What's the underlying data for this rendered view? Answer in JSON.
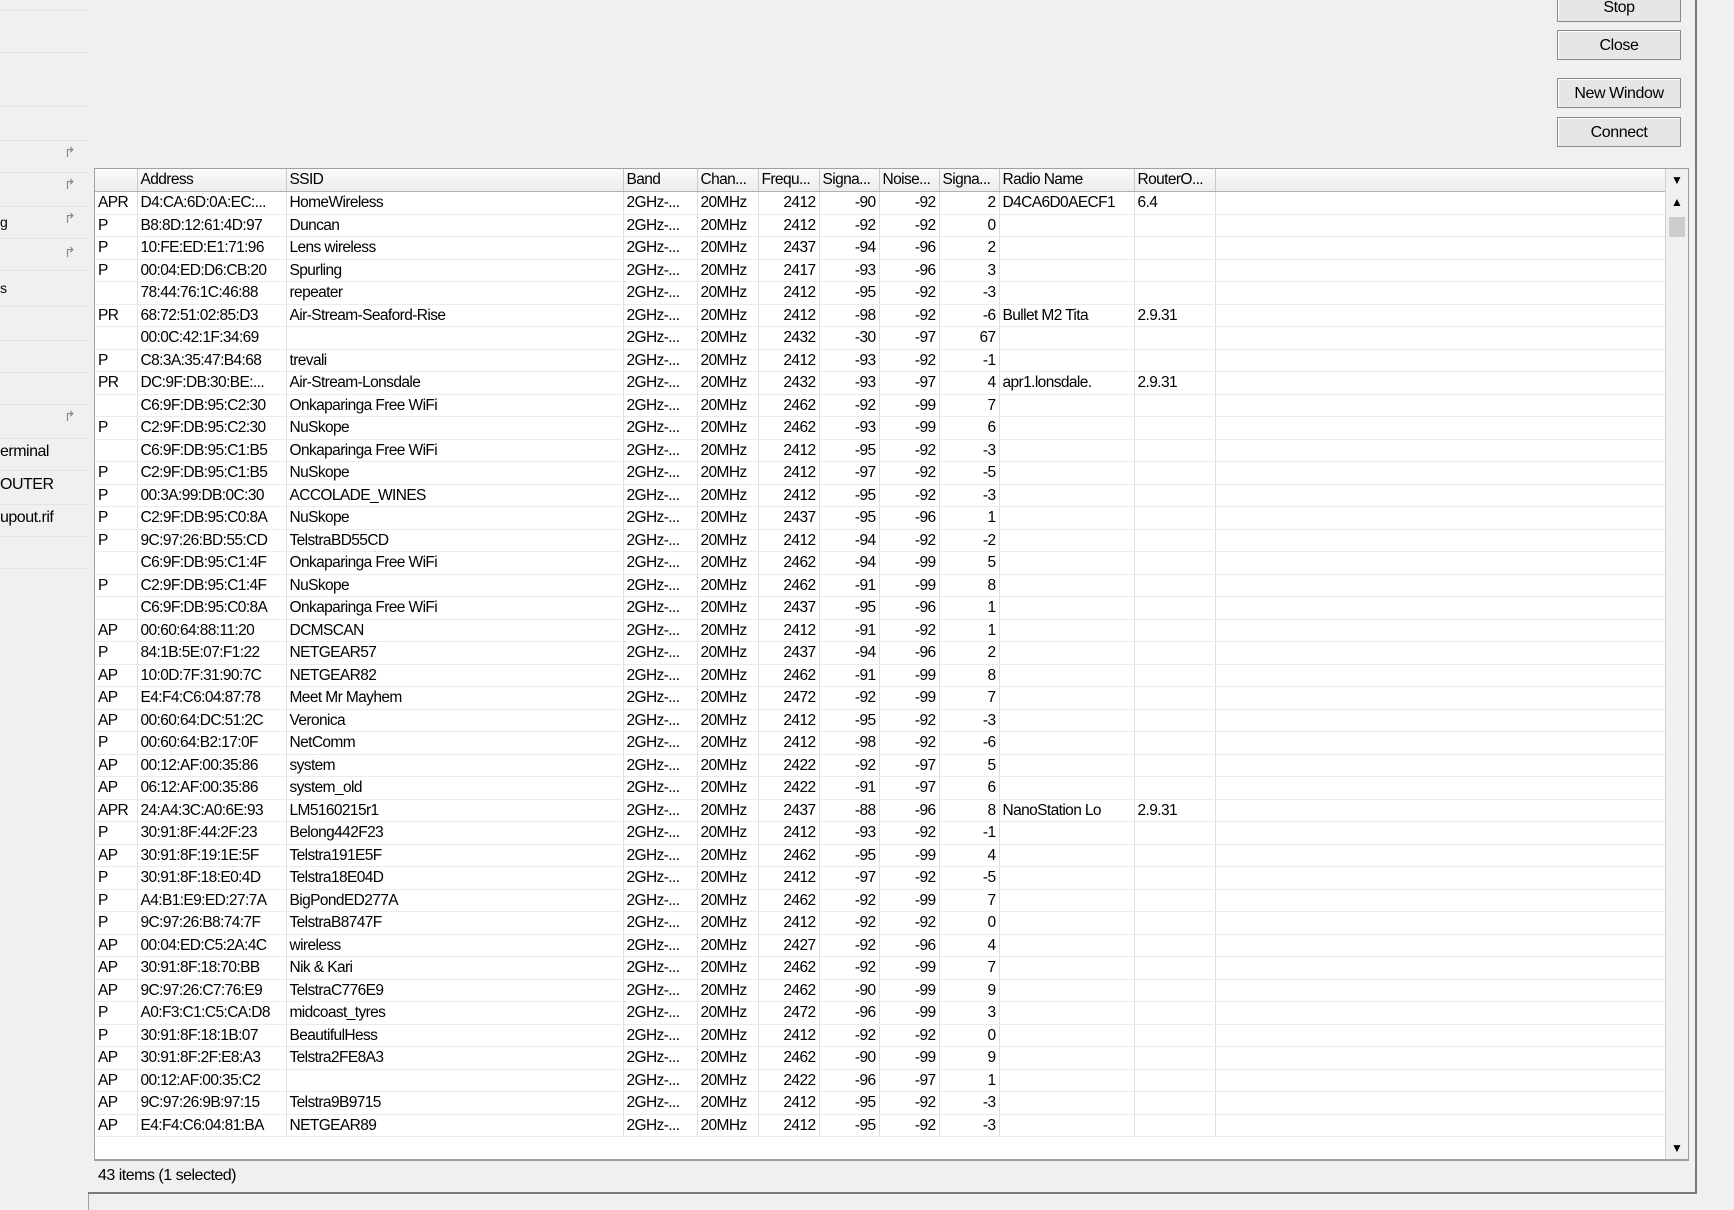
{
  "sidebar": {
    "items": [
      "erminal",
      "OUTER",
      "upout.rif"
    ],
    "marks": [
      "g",
      "s"
    ]
  },
  "buttons": {
    "stop": "Stop",
    "close": "Close",
    "new_window": "New Window",
    "connect": "Connect"
  },
  "table": {
    "columns": [
      "",
      "Address",
      "SSID",
      "Band",
      "Chan...",
      "Frequ...",
      "Signa...",
      "Noise...",
      "Signa...",
      "Radio Name",
      "RouterO..."
    ],
    "rows": [
      [
        "APR",
        "D4:CA:6D:0A:EC:...",
        "HomeWireless",
        "2GHz-...",
        "20MHz",
        "2412",
        "-90",
        "-92",
        "2",
        "D4CA6D0AECF1",
        "6.4"
      ],
      [
        "P",
        "B8:8D:12:61:4D:97",
        "Duncan",
        "2GHz-...",
        "20MHz",
        "2412",
        "-92",
        "-92",
        "0",
        "",
        ""
      ],
      [
        "P",
        "10:FE:ED:E1:71:96",
        "Lens wireless",
        "2GHz-...",
        "20MHz",
        "2437",
        "-94",
        "-96",
        "2",
        "",
        ""
      ],
      [
        "P",
        "00:04:ED:D6:CB:20",
        "Spurling",
        "2GHz-...",
        "20MHz",
        "2417",
        "-93",
        "-96",
        "3",
        "",
        ""
      ],
      [
        "",
        "78:44:76:1C:46:88",
        "repeater",
        "2GHz-...",
        "20MHz",
        "2412",
        "-95",
        "-92",
        "-3",
        "",
        ""
      ],
      [
        "PR",
        "68:72:51:02:85:D3",
        "Air-Stream-Seaford-Rise",
        "2GHz-...",
        "20MHz",
        "2412",
        "-98",
        "-92",
        "-6",
        "Bullet M2 Tita",
        "2.9.31"
      ],
      [
        "",
        "00:0C:42:1F:34:69",
        "",
        "2GHz-...",
        "20MHz",
        "2432",
        "-30",
        "-97",
        "67",
        "",
        ""
      ],
      [
        "P",
        "C8:3A:35:47:B4:68",
        "trevali",
        "2GHz-...",
        "20MHz",
        "2412",
        "-93",
        "-92",
        "-1",
        "",
        ""
      ],
      [
        "PR",
        "DC:9F:DB:30:BE:...",
        "Air-Stream-Lonsdale",
        "2GHz-...",
        "20MHz",
        "2432",
        "-93",
        "-97",
        "4",
        "apr1.lonsdale.",
        "2.9.31"
      ],
      [
        "",
        "C6:9F:DB:95:C2:30",
        "Onkaparinga Free WiFi",
        "2GHz-...",
        "20MHz",
        "2462",
        "-92",
        "-99",
        "7",
        "",
        ""
      ],
      [
        "P",
        "C2:9F:DB:95:C2:30",
        "NuSkope",
        "2GHz-...",
        "20MHz",
        "2462",
        "-93",
        "-99",
        "6",
        "",
        ""
      ],
      [
        "",
        "C6:9F:DB:95:C1:B5",
        "Onkaparinga Free WiFi",
        "2GHz-...",
        "20MHz",
        "2412",
        "-95",
        "-92",
        "-3",
        "",
        ""
      ],
      [
        "P",
        "C2:9F:DB:95:C1:B5",
        "NuSkope",
        "2GHz-...",
        "20MHz",
        "2412",
        "-97",
        "-92",
        "-5",
        "",
        ""
      ],
      [
        "P",
        "00:3A:99:DB:0C:30",
        "ACCOLADE_WINES",
        "2GHz-...",
        "20MHz",
        "2412",
        "-95",
        "-92",
        "-3",
        "",
        ""
      ],
      [
        "P",
        "C2:9F:DB:95:C0:8A",
        "NuSkope",
        "2GHz-...",
        "20MHz",
        "2437",
        "-95",
        "-96",
        "1",
        "",
        ""
      ],
      [
        "P",
        "9C:97:26:BD:55:CD",
        "TelstraBD55CD",
        "2GHz-...",
        "20MHz",
        "2412",
        "-94",
        "-92",
        "-2",
        "",
        ""
      ],
      [
        "",
        "C6:9F:DB:95:C1:4F",
        "Onkaparinga Free WiFi",
        "2GHz-...",
        "20MHz",
        "2462",
        "-94",
        "-99",
        "5",
        "",
        ""
      ],
      [
        "P",
        "C2:9F:DB:95:C1:4F",
        "NuSkope",
        "2GHz-...",
        "20MHz",
        "2462",
        "-91",
        "-99",
        "8",
        "",
        ""
      ],
      [
        "",
        "C6:9F:DB:95:C0:8A",
        "Onkaparinga Free WiFi",
        "2GHz-...",
        "20MHz",
        "2437",
        "-95",
        "-96",
        "1",
        "",
        ""
      ],
      [
        "AP",
        "00:60:64:88:11:20",
        "DCMSCAN",
        "2GHz-...",
        "20MHz",
        "2412",
        "-91",
        "-92",
        "1",
        "",
        ""
      ],
      [
        "P",
        "84:1B:5E:07:F1:22",
        "NETGEAR57",
        "2GHz-...",
        "20MHz",
        "2437",
        "-94",
        "-96",
        "2",
        "",
        ""
      ],
      [
        "AP",
        "10:0D:7F:31:90:7C",
        "NETGEAR82",
        "2GHz-...",
        "20MHz",
        "2462",
        "-91",
        "-99",
        "8",
        "",
        ""
      ],
      [
        "AP",
        "E4:F4:C6:04:87:78",
        "Meet Mr Mayhem",
        "2GHz-...",
        "20MHz",
        "2472",
        "-92",
        "-99",
        "7",
        "",
        ""
      ],
      [
        "AP",
        "00:60:64:DC:51:2C",
        "Veronica",
        "2GHz-...",
        "20MHz",
        "2412",
        "-95",
        "-92",
        "-3",
        "",
        ""
      ],
      [
        "P",
        "00:60:64:B2:17:0F",
        "NetComm",
        "2GHz-...",
        "20MHz",
        "2412",
        "-98",
        "-92",
        "-6",
        "",
        ""
      ],
      [
        "AP",
        "00:12:AF:00:35:86",
        "system",
        "2GHz-...",
        "20MHz",
        "2422",
        "-92",
        "-97",
        "5",
        "",
        ""
      ],
      [
        "AP",
        "06:12:AF:00:35:86",
        "system_old",
        "2GHz-...",
        "20MHz",
        "2422",
        "-91",
        "-97",
        "6",
        "",
        ""
      ],
      [
        "APR",
        "24:A4:3C:A0:6E:93",
        "LM5160215r1",
        "2GHz-...",
        "20MHz",
        "2437",
        "-88",
        "-96",
        "8",
        "NanoStation Lo",
        "2.9.31"
      ],
      [
        "P",
        "30:91:8F:44:2F:23",
        "Belong442F23",
        "2GHz-...",
        "20MHz",
        "2412",
        "-93",
        "-92",
        "-1",
        "",
        ""
      ],
      [
        "AP",
        "30:91:8F:19:1E:5F",
        "Telstra191E5F",
        "2GHz-...",
        "20MHz",
        "2462",
        "-95",
        "-99",
        "4",
        "",
        ""
      ],
      [
        "P",
        "30:91:8F:18:E0:4D",
        "Telstra18E04D",
        "2GHz-...",
        "20MHz",
        "2412",
        "-97",
        "-92",
        "-5",
        "",
        ""
      ],
      [
        "P",
        "A4:B1:E9:ED:27:7A",
        "BigPondED277A",
        "2GHz-...",
        "20MHz",
        "2462",
        "-92",
        "-99",
        "7",
        "",
        ""
      ],
      [
        "P",
        "9C:97:26:B8:74:7F",
        "TelstraB8747F",
        "2GHz-...",
        "20MHz",
        "2412",
        "-92",
        "-92",
        "0",
        "",
        ""
      ],
      [
        "AP",
        "00:04:ED:C5:2A:4C",
        "wireless",
        "2GHz-...",
        "20MHz",
        "2427",
        "-92",
        "-96",
        "4",
        "",
        ""
      ],
      [
        "AP",
        "30:91:8F:18:70:BB",
        "Nik & Kari",
        "2GHz-...",
        "20MHz",
        "2462",
        "-92",
        "-99",
        "7",
        "",
        ""
      ],
      [
        "AP",
        "9C:97:26:C7:76:E9",
        "TelstraC776E9",
        "2GHz-...",
        "20MHz",
        "2462",
        "-90",
        "-99",
        "9",
        "",
        ""
      ],
      [
        "P",
        "A0:F3:C1:C5:CA:D8",
        "midcoast_tyres",
        "2GHz-...",
        "20MHz",
        "2472",
        "-96",
        "-99",
        "3",
        "",
        ""
      ],
      [
        "P",
        "30:91:8F:18:1B:07",
        "BeautifulHess",
        "2GHz-...",
        "20MHz",
        "2412",
        "-92",
        "-92",
        "0",
        "",
        ""
      ],
      [
        "AP",
        "30:91:8F:2F:E8:A3",
        "Telstra2FE8A3",
        "2GHz-...",
        "20MHz",
        "2462",
        "-90",
        "-99",
        "9",
        "",
        ""
      ],
      [
        "AP",
        "00:12:AF:00:35:C2",
        "",
        "2GHz-...",
        "20MHz",
        "2422",
        "-96",
        "-97",
        "1",
        "",
        ""
      ],
      [
        "AP",
        "9C:97:26:9B:97:15",
        "Telstra9B9715",
        "2GHz-...",
        "20MHz",
        "2412",
        "-95",
        "-92",
        "-3",
        "",
        ""
      ],
      [
        "AP",
        "E4:F4:C6:04:81:BA",
        "NETGEAR89",
        "2GHz-...",
        "20MHz",
        "2412",
        "-95",
        "-92",
        "-3",
        "",
        ""
      ]
    ]
  },
  "icons": {
    "menu_dropdown": "dropdown-arrow-icon",
    "scroll_up": "scroll-up-icon",
    "scroll_down": "scroll-down-icon"
  },
  "status": "43 items (1 selected)"
}
